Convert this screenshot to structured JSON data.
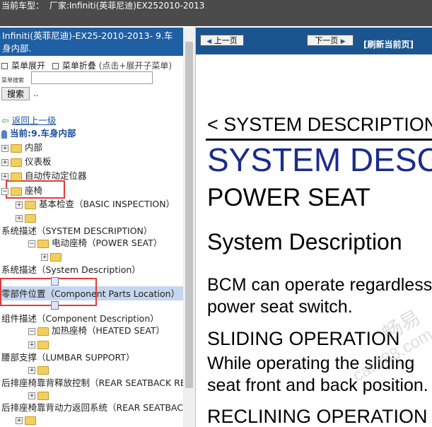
{
  "topbar": {
    "label": "当前车型：",
    "factory": "厂家:Infiniti(英菲尼迪)EX252010-2013"
  },
  "sidebar": {
    "title": "Infiniti(英菲尼迪)-EX25-2010-2013- 9.车身内部.",
    "expand": "菜单展开",
    "collapse": "菜单折叠",
    "collapse_hint": "(点击+展开子菜单)",
    "search_label": "菜单搜索",
    "search_value": "",
    "search_button": "搜索",
    "dots": "..",
    "back": "返回上一级",
    "current": "当前:9.车身内部",
    "nodes": [
      "内部",
      "仪表板",
      "自动传动定位器",
      "座椅",
      "基本检查（BASIC INSPECTION）",
      "系统描述（SYSTEM DESCRIPTION）",
      "电动座椅（POWER SEAT）",
      "系统描述（System Description）",
      "零部件位置（Component Parts Location）",
      "组件描述（Component Description）",
      "加热座椅（HEATED SEAT）",
      "腰部支撑（LUMBAR SUPPORT）",
      "后排座椅靠背释放控制（REAR SEATBACK RELEASE CONTROL）",
      "后排座椅靠背动力返回系统（REAR SEATBACK POWER RETURN SYSTEM）"
    ]
  },
  "toolbar": {
    "prev": "上一页",
    "next": "下一页",
    "refresh": "[刷新当前页]"
  },
  "document": {
    "breadcrumb": "< SYSTEM DESCRIPTION >",
    "heading": "SYSTEM DESCRIPTION",
    "subheading": "POWER SEAT",
    "section": "System Description",
    "para1_line1": "BCM can operate regardless",
    "para1_line2": "power seat switch.",
    "op1": "SLIDING OPERATION",
    "para2_line1": "While operating the sliding",
    "para2_line2": "seat front and back position.",
    "op2": "RECLINING OPERATION"
  },
  "watermark": {
    "chinese": "畅易",
    "url": "car388.com"
  },
  "colors": {
    "topbar": "#4b4b4b",
    "title_bg": "#1f5fa4",
    "nav_bg": "#1a5590",
    "link": "#1a4fa0",
    "heading": "#1a2c8c",
    "highlight": "#e23b3b"
  }
}
